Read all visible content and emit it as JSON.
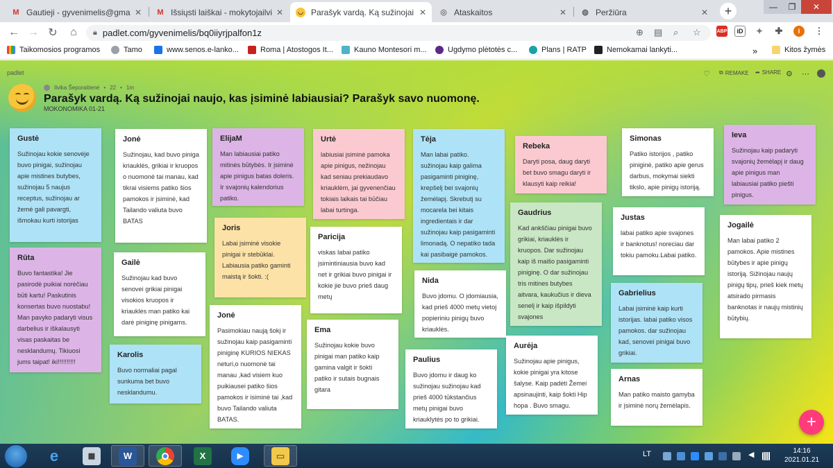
{
  "browser": {
    "tabs": [
      {
        "favicon": "gmail-icon",
        "label": "Gautieji - gyvenimelis@gmail.co"
      },
      {
        "favicon": "gmail-icon",
        "label": "Išsiųsti laiškai - mokytojailvika@"
      },
      {
        "favicon": "smile-emoji-icon",
        "label": "Parašyk vardą. Ką sužinojai nauj"
      },
      {
        "favicon": "report-icon",
        "label": "Ataskaitos"
      },
      {
        "favicon": "globe-icon",
        "label": "Peržiūra"
      }
    ],
    "url": "padlet.com/gyvenimelis/bq0iiyrjpalfon1z",
    "bookmarks": [
      {
        "icon": "apps-grid-icon",
        "label": "Taikomosios programos"
      },
      {
        "icon": "tamo-icon",
        "label": "Tamo"
      },
      {
        "icon": "e-icon",
        "label": "www.senos.e-lanko..."
      },
      {
        "icon": "roma-icon",
        "label": "Roma | Atostogos It..."
      },
      {
        "icon": "montessori-icon",
        "label": "Kauno Montesori m..."
      },
      {
        "icon": "uc-icon",
        "label": "Ugdymo plėtotės c..."
      },
      {
        "icon": "ratp-icon",
        "label": "Plans | RATP"
      },
      {
        "icon": "g-icon",
        "label": "Nemokamai lankyti..."
      }
    ],
    "bookmarks_more": "»",
    "other_bookmarks": "Kitos žymės",
    "extensions": [
      "ABP",
      "iD"
    ]
  },
  "padlet": {
    "logo": "padlet",
    "actions": {
      "remake": "REMAKE",
      "share": "SHARE"
    },
    "author": "Ilvika Šeporaitienė",
    "meta_sep": "•",
    "post_count": "22",
    "age": "1m",
    "title": "Parašyk vardą. Ką sužinojai naujo, kas įsiminė labiausiai? Parašyk savo nuomonę.",
    "subtitle": "MOKONOMIKA 01-21",
    "posts": [
      {
        "author": "Gustė",
        "color": "blue",
        "text": "Sužinojau kokie senovėje buvo pinigai, sužinojau apie mistines butybes, sužinojau 5 naujus receptus, sužinojau ar žemė gali pavargti, išmokau kurti istorijas"
      },
      {
        "author": "Rūta",
        "color": "purple",
        "text": "Buvo fantastika! Jie pasirodė puikiai norėčiau būti kartu! Paskutinis konsertas buvo nuostabu! Man pavyko padaryti visus darbelius ir iškalausyti visas paskaitas be nesklandumų. Tikiuosi jums taipat! iki!!!!!!!!!!"
      },
      {
        "author": "Jonė",
        "color": "white",
        "text": "Sužinojau, kad buvo piniga kriauklės, grikiai ir kruopos o nuomonė tai manau, kad tikrai visiems patiko šios pamokos ir įsiminė, kad Tailando valiuta buvo BATAS"
      },
      {
        "author": "Gailė",
        "color": "white",
        "text": "Sužinojau kad buvo senovei grikiai pinigai visokios kruopos ir kriauklės man patiko kai darė piniginę pinigams."
      },
      {
        "author": "Karolis",
        "color": "blue",
        "text": "Buvo normaliai pagal sunkuma bet buvo nesklandumu."
      },
      {
        "author": "ElijaM",
        "color": "purple",
        "text": "Man labiausiai patiko mitinės būtybės. Ir įsiminė apie pinigus batas doleris. Ir svajonių kalendorius patiko."
      },
      {
        "author": "Joris",
        "color": "yellow",
        "text": "Labai įsiminė visokie pinigai ir stebūklai. Labiausia patiko gaminti maistą ir šokti. :("
      },
      {
        "author": "Jonė",
        "color": "white",
        "text": "Pasimokiau naują šokį ir sužinojau kaip pasigaminti piniginę KURIOS NIEKAS neturi,o nuomonė tai manau ,kad visiem kuo puikiausei patiko šios pamokos ir isiminė tai ,kad buvo Tailando valiuta BATAS."
      },
      {
        "author": "Urtė",
        "color": "pink",
        "text": "labiusiai įsiminė pamoka apie pinigus, nežinojau kad seniau prekiaudavo kriauklėm, jai gyvenenčiau tokiais laikais tai būčiau labai turtinga."
      },
      {
        "author": "Paricija",
        "color": "white",
        "text": "viskas labai patiko įsimintiniausia buvo kad net ir grikiai buvo pinigai ir kokie jie buvo prieš daug metų"
      },
      {
        "author": "Ema",
        "color": "white",
        "text": "Sužinojau  kokie  buvo pinigai  man patiko  kaip gamina valgit ir  šokti patiko ir sutais bugnais gitara"
      },
      {
        "author": "Tėja",
        "color": "blue",
        "text": "Man labai patiko. sužinojau kaip galima pasigaminti piniginę, krepšelį bei svajonių žemėlapį. Skrebutį su mocarela bei kitais ingredientais ir dar sužinojau kaip pasigaminti limonadą. O nepatiko tada kai pasibaigė pamokos."
      },
      {
        "author": "Nida",
        "color": "white",
        "text": "Buvo jdomu. O įdomiausia, kad prieš  4000 metų vietoj popieriniu pinigų buvo kriauklės."
      },
      {
        "author": "Paulius",
        "color": "white",
        "text": "Buvo įdomu ir daug ko sužinojau sužinojau kad prieš 4000 tūkstančius metų pinigai buvo kriauklytės po to grikiai."
      },
      {
        "author": "Rebeka",
        "color": "pink",
        "text": "Daryti posa, daug daryti bet buvo smagu daryti ir klausyti kaip reikia!"
      },
      {
        "author": "Gaudrius",
        "color": "green",
        "text": "Kad ankščiau pinigai buvo grikiai, kriauklės ir kruopos. Dar sužinojau kaip iš maišo pasigaminti piniginę. O dar sužinojau tris mitines butybes aitvara, kaukučius ir dieva senelį ir kaip išpildyti svajones"
      },
      {
        "author": "Aurėja",
        "color": "white",
        "text": "Sužinojau apie pinigus, kokie pinigai yra kitose šalyse. Kaip padėti Žemei apsinaujinti, kaip šokti Hip hopa . Buvo smagu."
      },
      {
        "author": "Simonas",
        "color": "white",
        "text": "Patiko istorijos , patiko piniginė, patiko apie gerus darbus, mokymai siekti tikslo, apie pinigų istoriją."
      },
      {
        "author": "Justas",
        "color": "white",
        "text": "labai patiko apie svajones ir banknotus! noreciau dar tokiu pamoku.Labai patiko."
      },
      {
        "author": "Gabrielius",
        "color": "blue",
        "text": "Labai įsiminė kaip kurti istorijas. labai patiko visos pamokos. dar sužinojau kad, senovei pinigai buvo grikiai."
      },
      {
        "author": "Arnas",
        "color": "white",
        "text": "Man patiko  maisto gamyba ir įsiminė norų žemėlapis."
      },
      {
        "author": "Ieva",
        "color": "purple",
        "text": "Sužinojau kaip padaryti svajonių žemėlapį ir daug apie pinigus man labiausiai patiko piešti pinigus."
      },
      {
        "author": "Jogailė",
        "color": "white",
        "text": "Man labai patiko 2 pamokos. Apie mistines būtybes ir apie pinigų istoriją. Sižinojau naujų pinigų tipų, prieš kiek metų atsirado pirmasis banknotas ir naujų mistinių būtybių."
      }
    ],
    "fab": "+"
  },
  "taskbar": {
    "lang": "LT",
    "time": "14:16",
    "date": "2021.01.21"
  }
}
